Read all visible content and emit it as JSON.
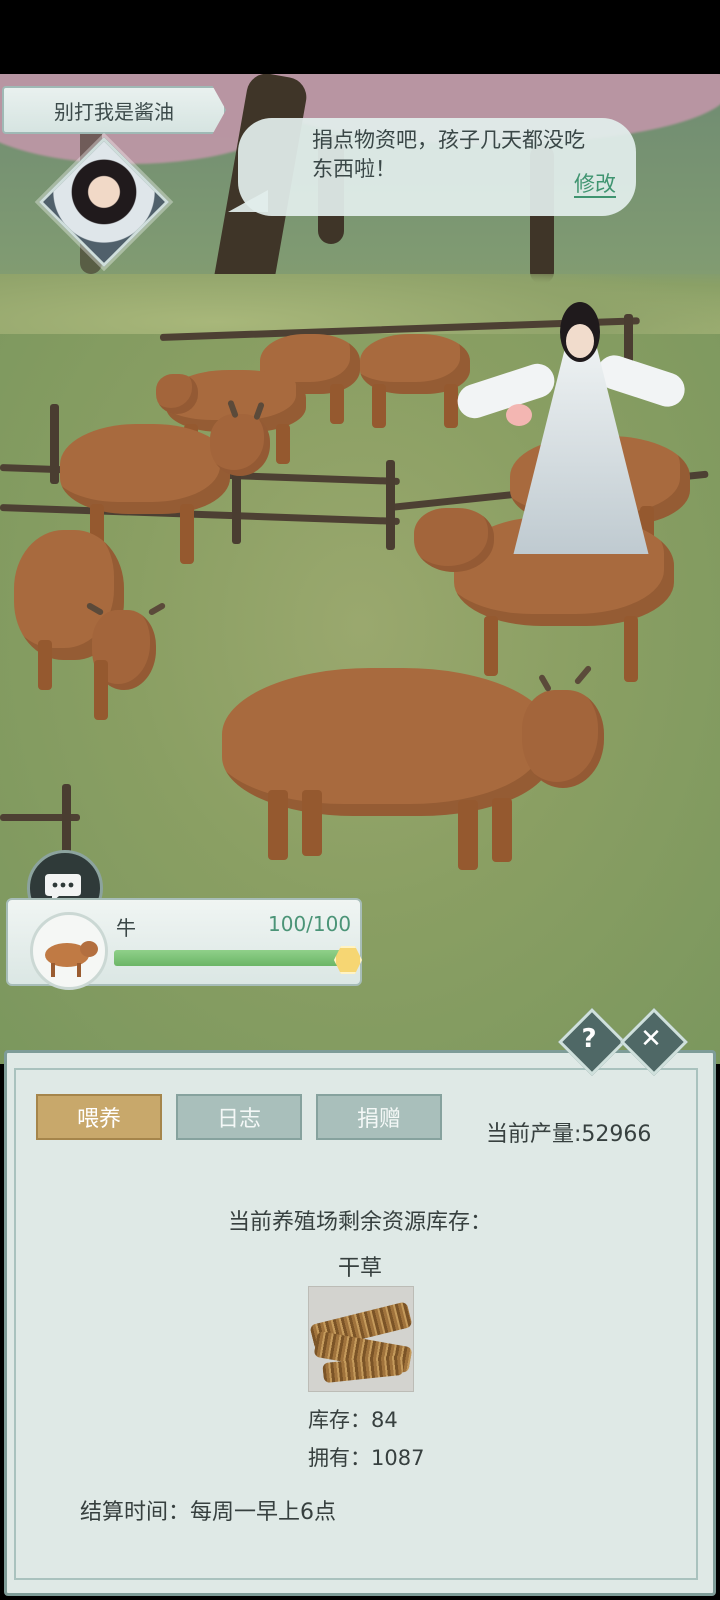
{
  "header": {
    "player_name": "别打我是酱油",
    "dialog_text": "捐点物资吧，孩子几天都没吃东西啦！",
    "edit_label": "修改"
  },
  "animal": {
    "name": "牛",
    "hp_text": "100/100",
    "hp_fraction": 1.0
  },
  "panel": {
    "tabs": [
      {
        "label": "喂养",
        "active": true
      },
      {
        "label": "日志",
        "active": false
      },
      {
        "label": "捐赠",
        "active": false
      }
    ],
    "production_text": "当前产量:52966",
    "stock_title": "当前养殖场剩余资源库存：",
    "item_name": "干草",
    "stock_text": "库存：84",
    "owned_text": "拥有：1087",
    "settle_text": "结算时间：每周一早上6点",
    "help_glyph": "?",
    "close_glyph": "✕"
  },
  "icons": [
    "chat-bubble-icon",
    "help-icon",
    "close-icon",
    "hay-bundle-icon",
    "cow-avatar-icon",
    "character-portrait-icon"
  ],
  "colors": {
    "accent_green": "#3f9470",
    "active_tab": "#c8a86b",
    "inactive_tab": "#a9bfbb",
    "panel_bg": "#dfe9e6"
  }
}
